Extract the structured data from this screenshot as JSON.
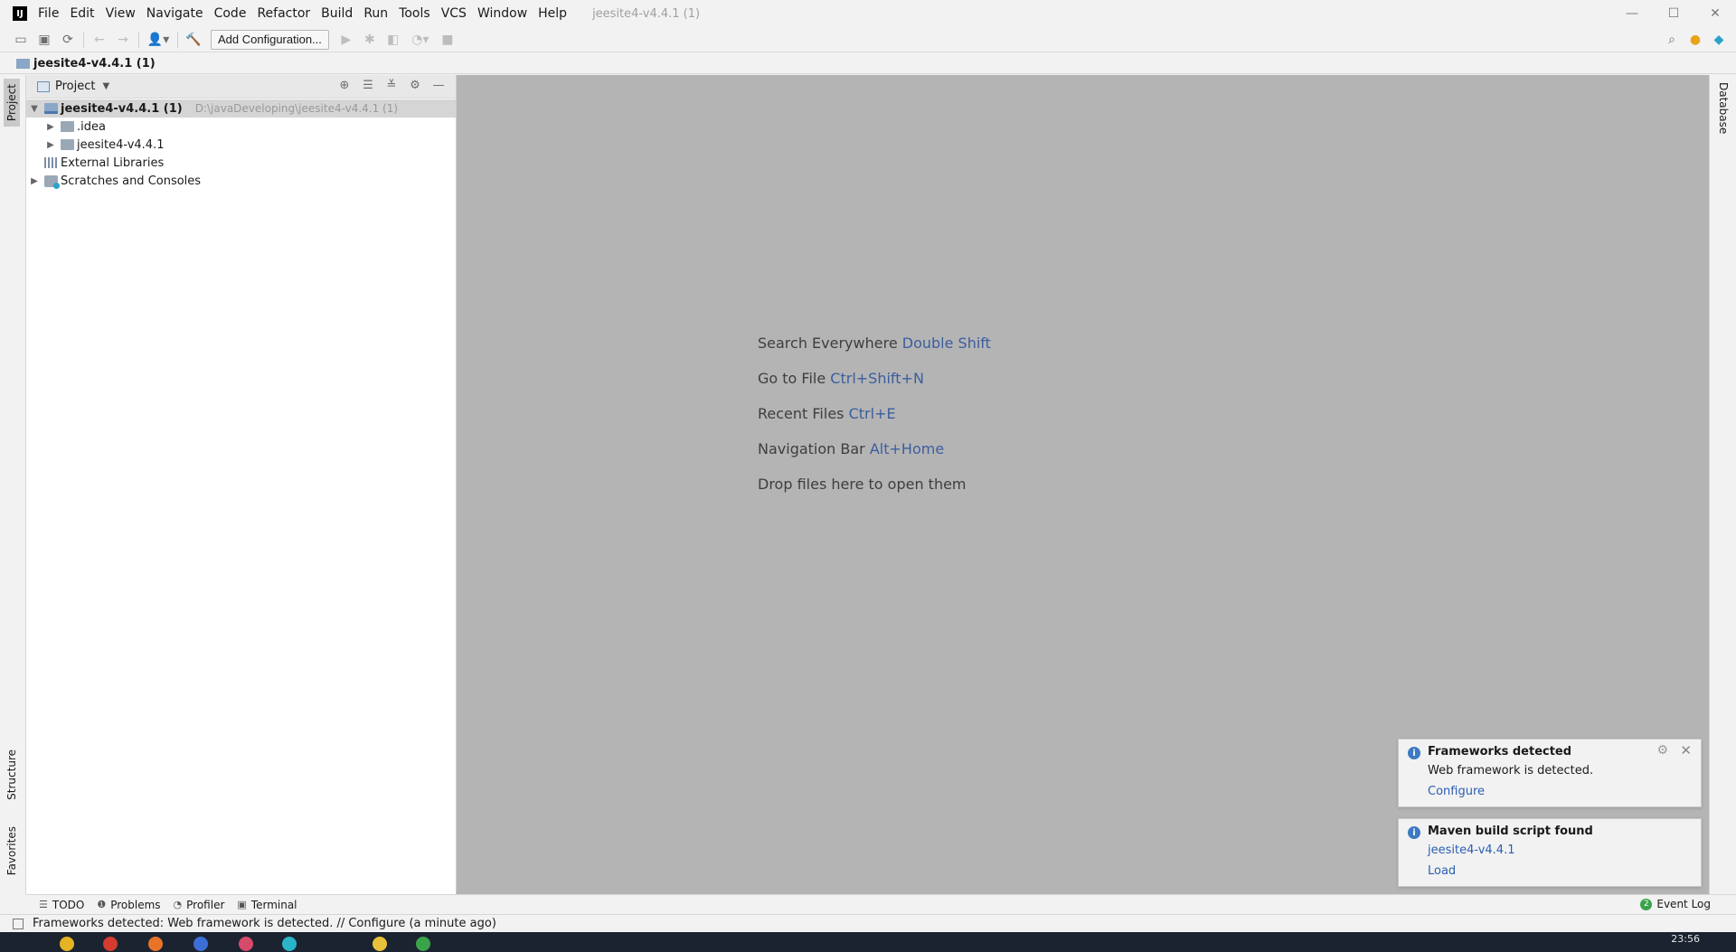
{
  "menu": [
    "File",
    "Edit",
    "View",
    "Navigate",
    "Code",
    "Refactor",
    "Build",
    "Run",
    "Tools",
    "VCS",
    "Window",
    "Help"
  ],
  "window_title": "jeesite4-v4.4.1  (1)",
  "toolbar": {
    "add_config_label": "Add Configuration..."
  },
  "navbar": {
    "crumb": "jeesite4-v4.4.1  (1)"
  },
  "left_stripe": {
    "project": "Project",
    "structure": "Structure",
    "favorites": "Favorites"
  },
  "right_stripe": {
    "database": "Database"
  },
  "project_panel": {
    "title": "Project",
    "tree": [
      {
        "label": "jeesite4-v4.4.1  (1)",
        "path": "D:\\javaDeveloping\\jeesite4-v4.4.1  (1)"
      },
      {
        "label": ".idea"
      },
      {
        "label": "jeesite4-v4.4.1"
      },
      {
        "label": "External Libraries"
      },
      {
        "label": "Scratches and Consoles"
      }
    ]
  },
  "editor_hints": [
    {
      "text": "Search Everywhere",
      "key": "Double Shift"
    },
    {
      "text": "Go to File",
      "key": "Ctrl+Shift+N"
    },
    {
      "text": "Recent Files",
      "key": "Ctrl+E"
    },
    {
      "text": "Navigation Bar",
      "key": "Alt+Home"
    },
    {
      "text": "Drop files here to open them",
      "key": ""
    }
  ],
  "notifications": [
    {
      "title": "Frameworks detected",
      "body": "Web framework is detected.",
      "link": "Configure"
    },
    {
      "title": "Maven build script found",
      "body": "jeesite4-v4.4.1",
      "link": "Load"
    }
  ],
  "bottom_tools": {
    "todo": "TODO",
    "problems": "Problems",
    "profiler": "Profiler",
    "terminal": "Terminal",
    "event_log": "Event Log",
    "event_count": "2"
  },
  "status": {
    "text": "Frameworks detected: Web framework is detected. // Configure (a minute ago)"
  },
  "clock": "23:56",
  "colors": {
    "editor_bg": "#b4b4b4",
    "link": "#2a5fb3",
    "shortcut": "#3b5e9e"
  }
}
